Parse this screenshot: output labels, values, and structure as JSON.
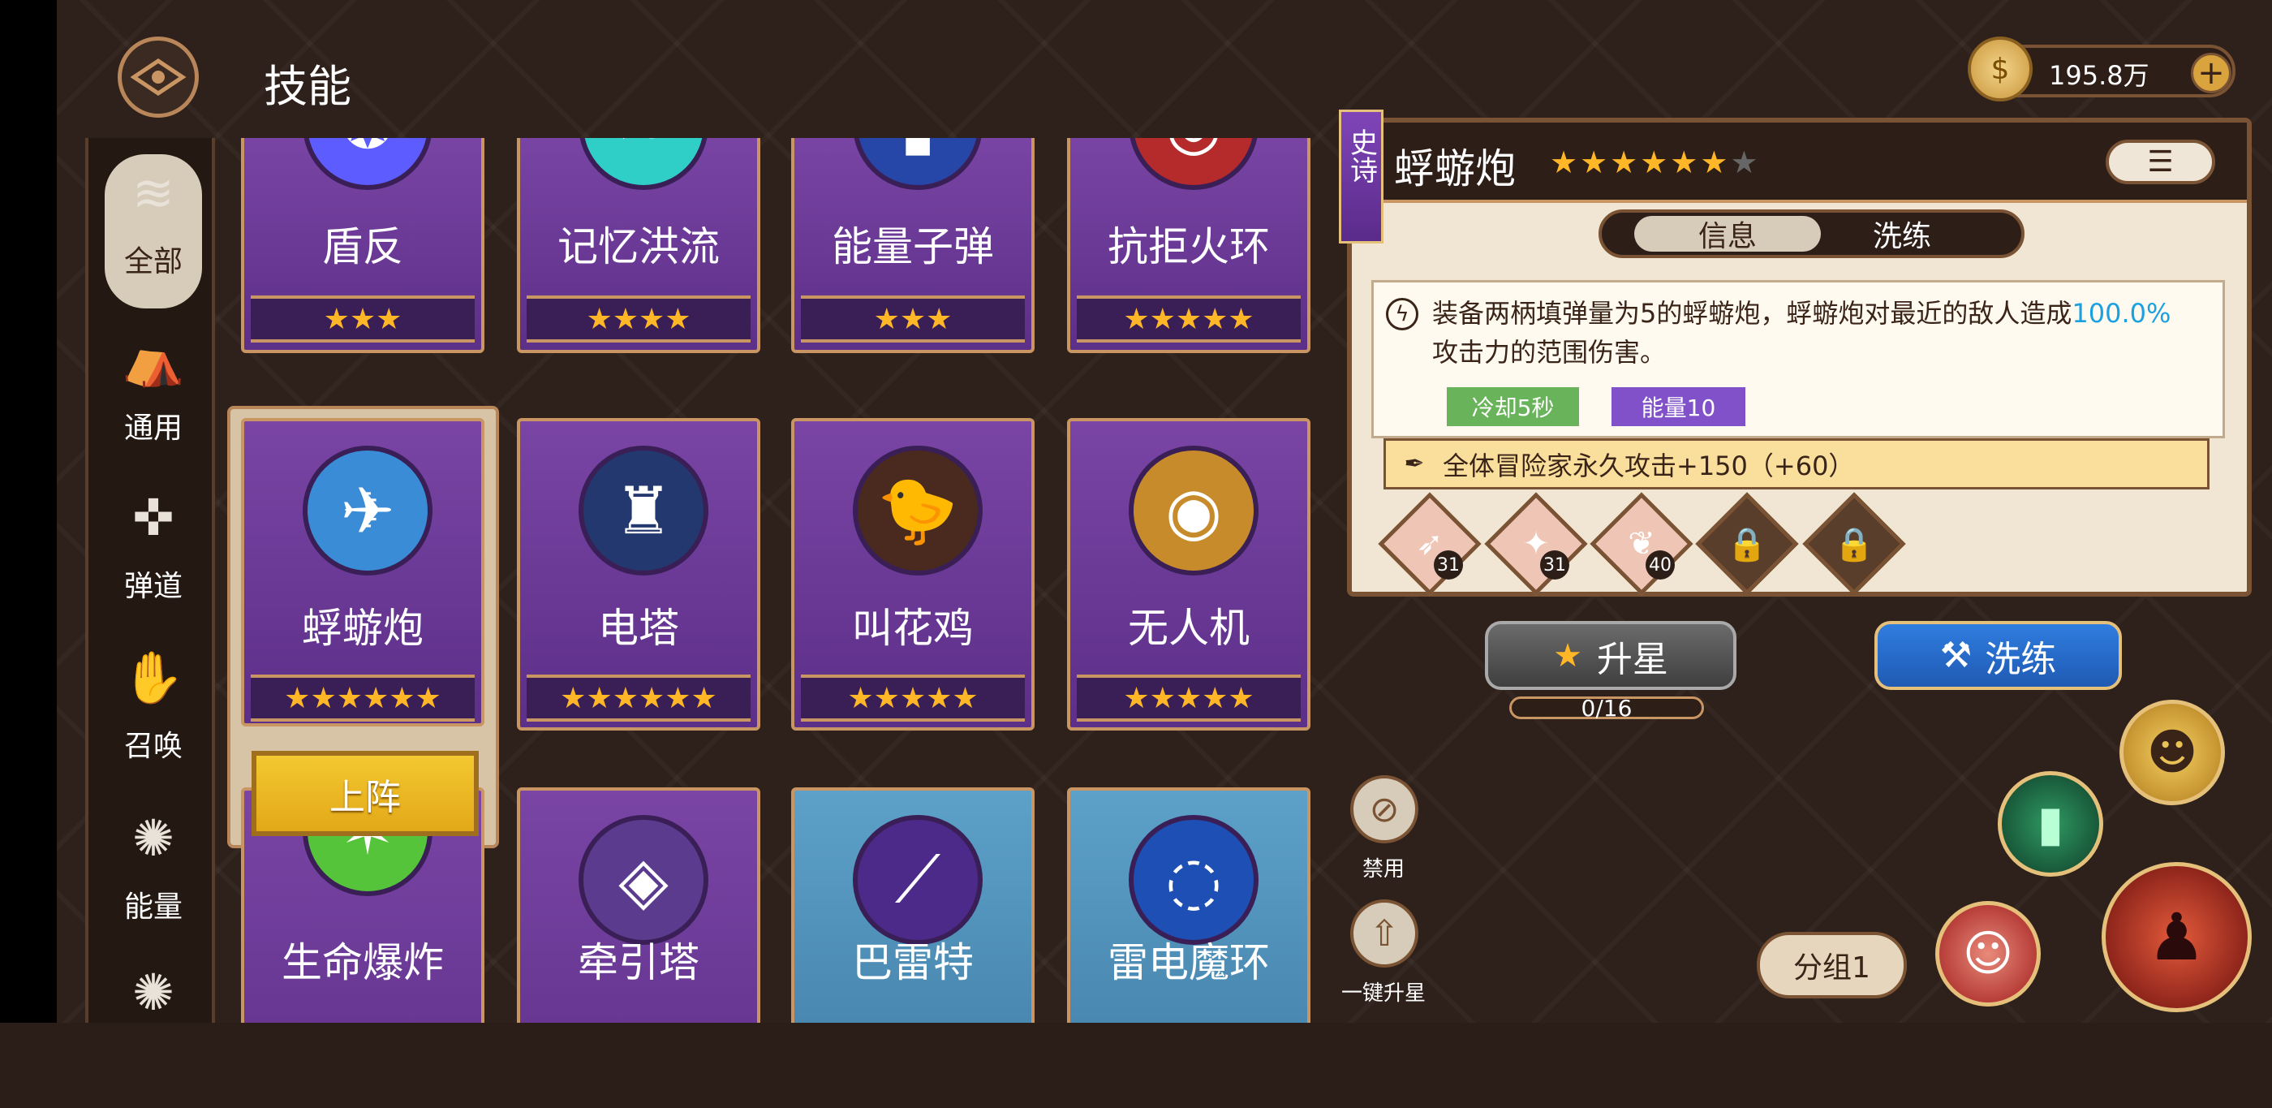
{
  "page": {
    "title": "技能"
  },
  "currency": {
    "amount": "195.8万"
  },
  "sidebar": {
    "items": [
      {
        "label": "全部",
        "icon": "all-scroll-icon",
        "glyph": "≋"
      },
      {
        "label": "通用",
        "icon": "tent-icon",
        "glyph": "⛺"
      },
      {
        "label": "弹道",
        "icon": "crosshair-icon",
        "glyph": "✜"
      },
      {
        "label": "召唤",
        "icon": "summon-hand-icon",
        "glyph": "✋"
      },
      {
        "label": "能量",
        "icon": "energy-burst-icon",
        "glyph": "✺"
      }
    ]
  },
  "skills": [
    {
      "name": "盾反",
      "stars": "★★★",
      "icon": "shield-counter-icon",
      "glyph": "❂",
      "color": "#5d5cff"
    },
    {
      "name": "记忆洪流",
      "stars": "★★★★",
      "icon": "memory-flood-icon",
      "glyph": "≈",
      "color": "#2fcfc8"
    },
    {
      "name": "能量子弹",
      "stars": "★★★",
      "icon": "energy-bullet-icon",
      "glyph": "▮",
      "color": "#2646a8"
    },
    {
      "name": "抗拒火环",
      "stars": "★★★★★",
      "icon": "fire-ring-icon",
      "glyph": "◎",
      "color": "#b52a2a"
    },
    {
      "name": "蜉蝣炮",
      "stars": "★★★★★★",
      "icon": "mayfly-cannon-icon",
      "glyph": "✈",
      "color": "#3a8cd6"
    },
    {
      "name": "电塔",
      "stars": "★★★★★★",
      "icon": "electric-tower-icon",
      "glyph": "♜",
      "color": "#22386e"
    },
    {
      "name": "叫花鸡",
      "stars": "★★★★★",
      "icon": "chicken-icon",
      "glyph": "🐤",
      "color": "#4a2a1e"
    },
    {
      "name": "无人机",
      "stars": "★★★★★",
      "icon": "drone-eye-icon",
      "glyph": "◉",
      "color": "#c88b2c"
    },
    {
      "name": "生命爆炸",
      "stars": "",
      "icon": "life-burst-icon",
      "glyph": "✶",
      "color": "#55c43a"
    },
    {
      "name": "牵引塔",
      "stars": "",
      "icon": "traction-tower-icon",
      "glyph": "◈",
      "color": "#5b3b8e"
    },
    {
      "name": "巴雷特",
      "stars": "",
      "icon": "barrett-icon",
      "glyph": "⟋",
      "color": "#4c2a8a"
    },
    {
      "name": "雷电魔环",
      "stars": "",
      "icon": "thunder-ring-icon",
      "glyph": "◌",
      "color": "#1e4fb5"
    }
  ],
  "deploy_label": "上阵",
  "detail": {
    "rank": "史诗",
    "title": "蜉蝣炮",
    "stars_on": "★★★★★★",
    "stars_off": "★",
    "tabs": [
      "信息",
      "洗练"
    ],
    "description_main": "装备两柄填弹量为5的蜉蝣炮，蜉蝣炮对最近的敌人造成",
    "description_value": "100.0%",
    "description_tail": "攻击力的范围伤害。",
    "cooldown": "冷却5秒",
    "energy": "能量10",
    "bonus": "全体冒险家永久攻击+150（+60）",
    "runes": [
      {
        "level": "31",
        "glyph": "➶"
      },
      {
        "level": "31",
        "glyph": "✦"
      },
      {
        "level": "40",
        "glyph": "❦"
      },
      {
        "level": "",
        "glyph": "🔒"
      },
      {
        "level": "",
        "glyph": "🔒"
      }
    ]
  },
  "actions": {
    "upstar": "升星",
    "progress": "0/16",
    "refine": "洗练",
    "ban": "禁用",
    "one_click_upstar": "一键升星",
    "group": "分组1"
  }
}
